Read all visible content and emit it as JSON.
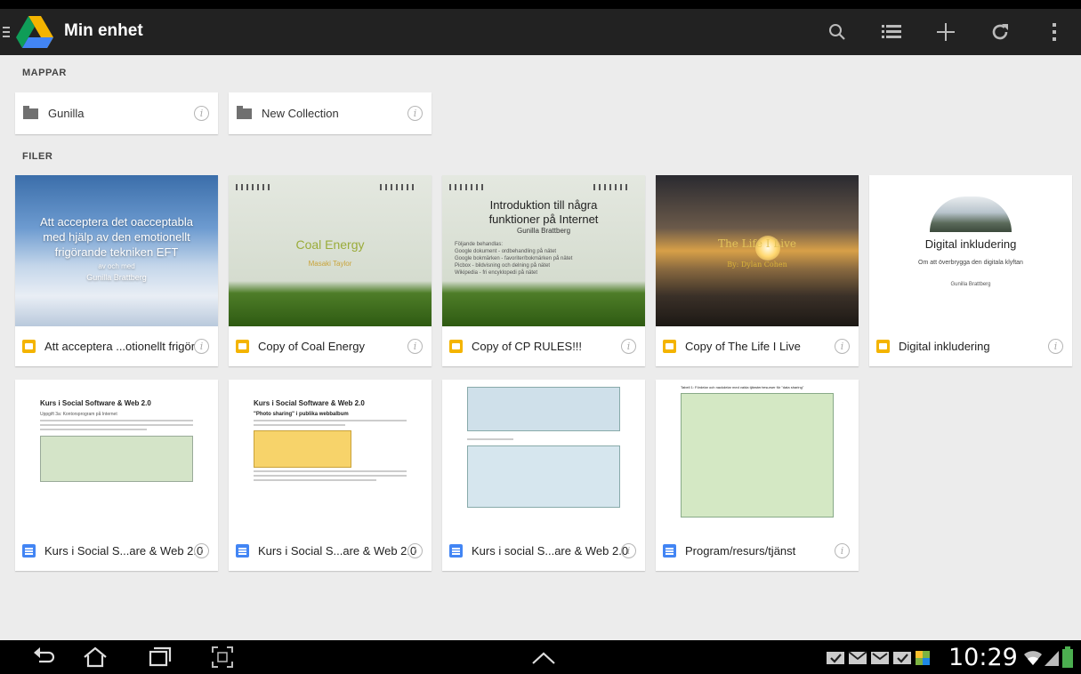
{
  "app": {
    "title": "Min enhet"
  },
  "sections": {
    "folders": "MAPPAR",
    "files": "FILER"
  },
  "folders": [
    {
      "name": "Gunilla"
    },
    {
      "name": "New Collection"
    }
  ],
  "files": [
    {
      "name": "Att acceptera ...otionellt frigör",
      "type": "slides",
      "thumb": {
        "line1": "Att acceptera det oacceptabla",
        "line2": "med hjälp av den emotionellt",
        "line3": "frigörande tekniken EFT",
        "line4": "av och med",
        "line5": "Gunilla Brattberg"
      }
    },
    {
      "name": "Copy of Coal Energy",
      "type": "slides",
      "thumb": {
        "title": "Coal Energy",
        "subtitle": "Masaki Taylor"
      }
    },
    {
      "name": "Copy of CP RULES!!!",
      "type": "slides",
      "thumb": {
        "title1": "Introduktion till några",
        "title2": "funktioner på Internet",
        "author": "Gunilla Brattberg",
        "intro": "Följande behandlas:",
        "bullets": [
          "Google dokument - ordbehandling på nätet",
          "Google bokmärken - favoriter/bokmärken på nätet",
          "Picbox - bildvisning och delning på nätet",
          "Wikipedia - fri encyklopedi på nätet"
        ]
      }
    },
    {
      "name": "Copy of The Life I Live",
      "type": "slides",
      "thumb": {
        "title": "The Life I Live",
        "subtitle": "By: Dylan Cohen"
      }
    },
    {
      "name": "Digital inkludering",
      "type": "slides",
      "thumb": {
        "title": "Digital inkludering",
        "subtitle": "Om att överbrygga den digitala klyftan",
        "author": "Gunilla Brattberg"
      }
    },
    {
      "name": "Kurs i Social S...are & Web 2.0",
      "type": "docs",
      "thumb": {
        "title": "Kurs i Social Software & Web 2.0",
        "subtitle": "Uppgift 3a: Kontorsprogram på Internet"
      }
    },
    {
      "name": "Kurs i Social S...are & Web 2.0",
      "type": "docs",
      "thumb": {
        "title": "Kurs i Social Software & Web 2.0",
        "subtitle": "\"Photo sharing\" i publika webbalbum"
      }
    },
    {
      "name": "Kurs i social S...are & Web 2.0",
      "type": "docs",
      "thumb": {
        "title": "",
        "subtitle": ""
      }
    },
    {
      "name": "Program/resurs/tjänst",
      "type": "docs",
      "thumb": {
        "title": "Tabell 1: Fördelar och nackdelar med valda tjänster/resurser för \"data sharing\"",
        "subtitle": ""
      }
    }
  ],
  "status": {
    "time": "10:29"
  },
  "colors": {
    "appbar": "#222222",
    "background": "#ececec",
    "slides": "#f4b400",
    "docs": "#4285f4"
  }
}
